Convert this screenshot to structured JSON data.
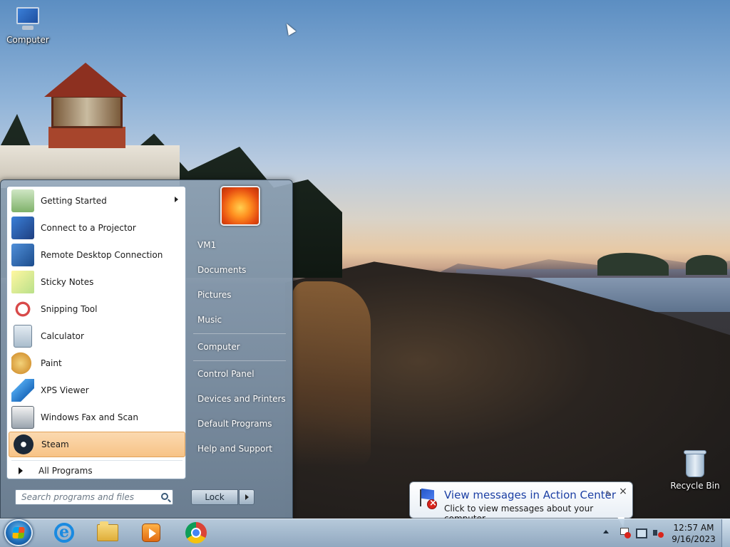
{
  "desktop": {
    "icons": [
      {
        "label": "Computer",
        "icon": "computer-icon"
      },
      {
        "label": "Recycle Bin",
        "icon": "recycle-bin-icon"
      }
    ]
  },
  "start_menu": {
    "programs": [
      {
        "label": "Getting Started",
        "icon": "getting-started-icon",
        "submenu": true
      },
      {
        "label": "Connect to a Projector",
        "icon": "projector-icon"
      },
      {
        "label": "Remote Desktop Connection",
        "icon": "remote-desktop-icon"
      },
      {
        "label": "Sticky Notes",
        "icon": "sticky-notes-icon"
      },
      {
        "label": "Snipping Tool",
        "icon": "snipping-tool-icon"
      },
      {
        "label": "Calculator",
        "icon": "calculator-icon"
      },
      {
        "label": "Paint",
        "icon": "paint-icon"
      },
      {
        "label": "XPS Viewer",
        "icon": "xps-viewer-icon"
      },
      {
        "label": "Windows Fax and Scan",
        "icon": "fax-scan-icon"
      },
      {
        "label": "Steam",
        "icon": "steam-icon",
        "highlighted": true
      }
    ],
    "all_programs_label": "All Programs",
    "search_placeholder": "Search programs and files",
    "right_links": {
      "user": "VM1",
      "documents": "Documents",
      "pictures": "Pictures",
      "music": "Music",
      "computer": "Computer",
      "control_panel": "Control Panel",
      "devices_printers": "Devices and Printers",
      "default_programs": "Default Programs",
      "help_support": "Help and Support"
    },
    "lock_label": "Lock"
  },
  "taskbar": {
    "pinned": [
      "internet-explorer-icon",
      "windows-explorer-icon",
      "media-player-icon",
      "chrome-icon"
    ],
    "clock_time": "12:57 AM",
    "clock_date": "9/16/2023"
  },
  "notification": {
    "title": "View messages in Action Center",
    "text": "Click to view messages about your computer."
  },
  "colors": {
    "highlight": "#f7c386",
    "balloon_title": "#1c3fa4"
  }
}
